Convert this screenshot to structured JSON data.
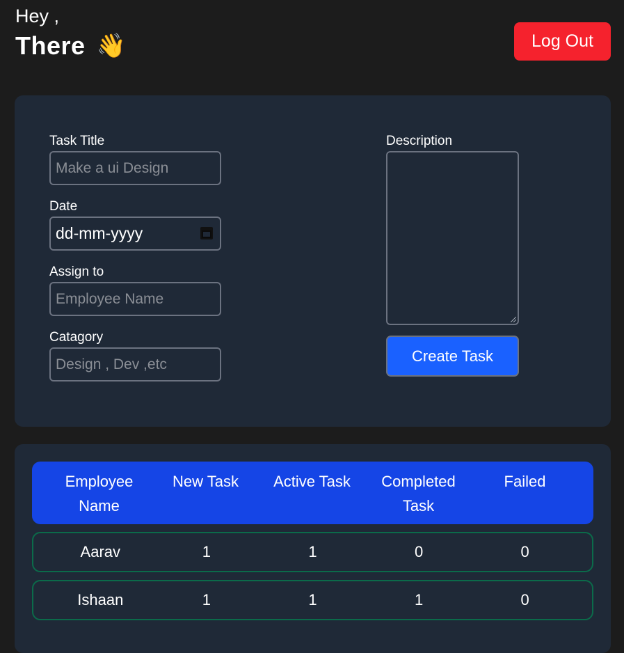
{
  "header": {
    "greeting": "Hey ,",
    "name": "There",
    "wave_emoji": "👋",
    "logout_label": "Log Out"
  },
  "form": {
    "task_title": {
      "label": "Task Title",
      "placeholder": "Make a ui Design"
    },
    "date": {
      "label": "Date",
      "value": "dd-mm-yyyy"
    },
    "assign_to": {
      "label": "Assign to",
      "placeholder": "Employee Name"
    },
    "category": {
      "label": "Catagory",
      "placeholder": "Design , Dev ,etc"
    },
    "description": {
      "label": "Description"
    },
    "create_label": "Create Task"
  },
  "table": {
    "headers": [
      "Employee Name",
      "New Task",
      "Active Task",
      "Completed Task",
      "Failed"
    ],
    "rows": [
      {
        "name": "Aarav",
        "new": "1",
        "active": "1",
        "completed": "0",
        "failed": "0"
      },
      {
        "name": "Ishaan",
        "new": "1",
        "active": "1",
        "completed": "1",
        "failed": "0"
      }
    ]
  },
  "colors": {
    "background": "#1c1c1c",
    "card": "#1f2937",
    "logout": "#f5222d",
    "primary": "#1a61ff",
    "table_header": "#1545e6",
    "row_border": "#0b6b4a"
  }
}
